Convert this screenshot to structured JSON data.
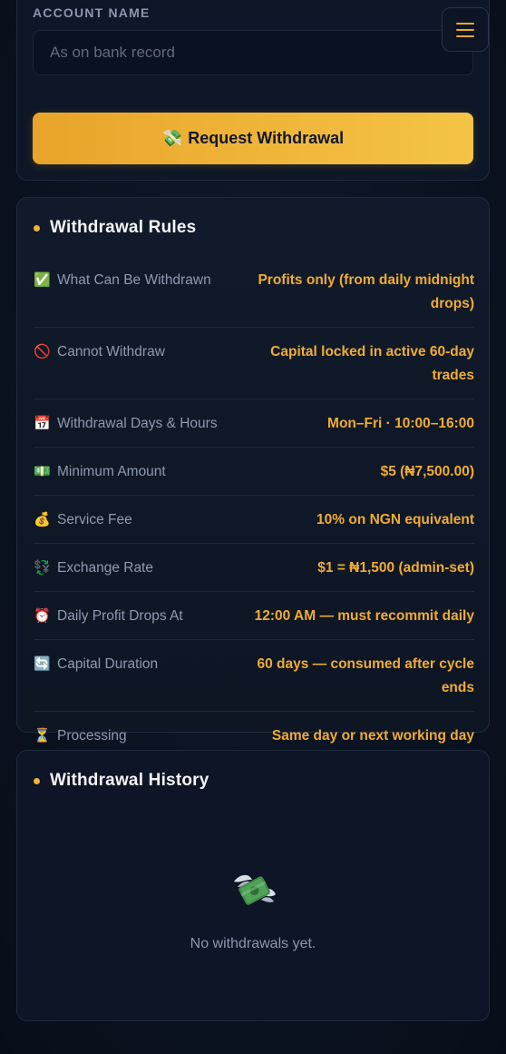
{
  "account": {
    "label": "ACCOUNT NAME",
    "placeholder": "As on bank record",
    "value": ""
  },
  "menu": {
    "icon": "hamburger-menu-icon"
  },
  "request_button": {
    "icon": "money-wings-emoji",
    "emoji": "💸",
    "label": "Request Withdrawal"
  },
  "rules": {
    "title": "Withdrawal Rules",
    "items": [
      {
        "icon": "check-mark-icon",
        "emoji": "✅",
        "label": "What Can Be Withdrawn",
        "value": "Profits only (from daily midnight drops)"
      },
      {
        "icon": "prohibited-icon",
        "emoji": "🚫",
        "label": "Cannot Withdraw",
        "value": "Capital locked in active 60-day trades"
      },
      {
        "icon": "calendar-icon",
        "emoji": "📅",
        "label": "Withdrawal Days & Hours",
        "value": "Mon–Fri · 10:00–16:00"
      },
      {
        "icon": "banknote-icon",
        "emoji": "💵",
        "label": "Minimum Amount",
        "value": "$5 (₦7,500.00)"
      },
      {
        "icon": "money-bag-icon",
        "emoji": "💰",
        "label": "Service Fee",
        "value": "10% on NGN equivalent"
      },
      {
        "icon": "currency-exchange-icon",
        "emoji": "💱",
        "label": "Exchange Rate",
        "value": "$1 = ₦1,500 (admin-set)"
      },
      {
        "icon": "alarm-clock-icon",
        "emoji": "⏰",
        "label": "Daily Profit Drops At",
        "value": "12:00 AM — must recommit daily"
      },
      {
        "icon": "cycle-arrows-icon",
        "emoji": "🔄",
        "label": "Capital Duration",
        "value": "60 days — consumed after cycle ends"
      },
      {
        "icon": "hourglass-icon",
        "emoji": "⏳",
        "label": "Processing",
        "value": "Same day or next working day"
      }
    ]
  },
  "history": {
    "title": "Withdrawal History",
    "empty_icon": "money-with-wings-icon",
    "empty_text": "No withdrawals yet."
  },
  "colors": {
    "accent": "#f0ac33",
    "background": "#0b1220",
    "card_border": "#1f2a3d"
  }
}
